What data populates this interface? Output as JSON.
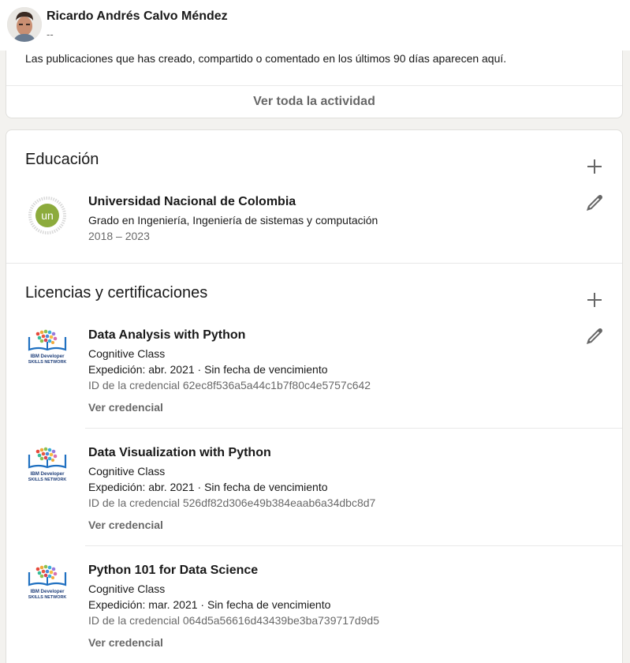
{
  "header": {
    "name": "Ricardo Andrés Calvo Méndez",
    "headline": "--"
  },
  "activity": {
    "text": "Las publicaciones que has creado, compartido o comentado en los últimos 90 días aparecen aquí.",
    "link": "Ver toda la actividad"
  },
  "education": {
    "title": "Educación",
    "items": [
      {
        "school": "Universidad Nacional de Colombia",
        "degree": "Grado en Ingeniería, Ingeniería de sistemas y computación",
        "dates": "2018 – 2023",
        "logo_text": "un",
        "logo_ring": "UNIVERSIDAD NACIONAL DE COLOMBIA"
      }
    ]
  },
  "certifications": {
    "title": "Licencias y certificaciones",
    "logo_line1": "IBM Developer",
    "logo_line2": "SKILLS NETWORK",
    "items": [
      {
        "name": "Data Analysis with Python",
        "issuer": "Cognitive Class",
        "issued": "Expedición: abr. 2021 · Sin fecha de vencimiento",
        "credential_id": "ID de la credencial 62ec8f536a5a44c1b7f80c4e5757c642",
        "link": "Ver credencial"
      },
      {
        "name": "Data Visualization with Python",
        "issuer": "Cognitive Class",
        "issued": "Expedición: abr. 2021 · Sin fecha de vencimiento",
        "credential_id": "ID de la credencial 526df82d306e49b384eaab6a34dbc8d7",
        "link": "Ver credencial"
      },
      {
        "name": "Python 101 for Data Science",
        "issuer": "Cognitive Class",
        "issued": "Expedición: mar. 2021 · Sin fecha de vencimiento",
        "credential_id": "ID de la credencial 064d5a56616d43439be3ba739717d9d5",
        "link": "Ver credencial"
      }
    ]
  },
  "colors": {
    "un_green": "#8cab3c",
    "ibm_blue": "#1f70c1"
  }
}
